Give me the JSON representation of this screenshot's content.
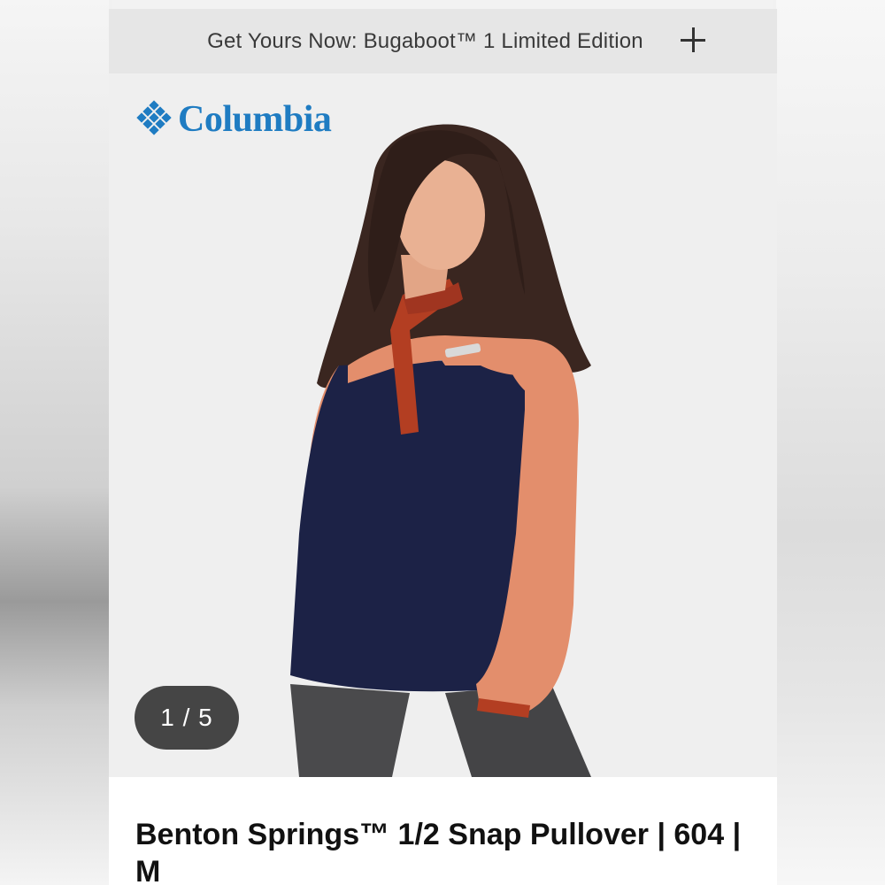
{
  "promo": {
    "text": "Get Yours Now: Bugaboot™ 1 Limited Edition",
    "expand_icon": "plus-icon"
  },
  "brand": {
    "name": "Columbia",
    "color": "#1f7cc2",
    "icon": "columbia-diamond-logo-icon"
  },
  "gallery": {
    "counter": "1 / 5",
    "current": 1,
    "total": 5
  },
  "product": {
    "title": "Benton Springs™ 1/2 Snap Pullover | 604 | M"
  },
  "colors": {
    "navy": "#1c2246",
    "peach": "#e38e6c",
    "rust": "#b33e22",
    "promo_bg": "#e6e6e6",
    "counter_bg": "#454545"
  }
}
